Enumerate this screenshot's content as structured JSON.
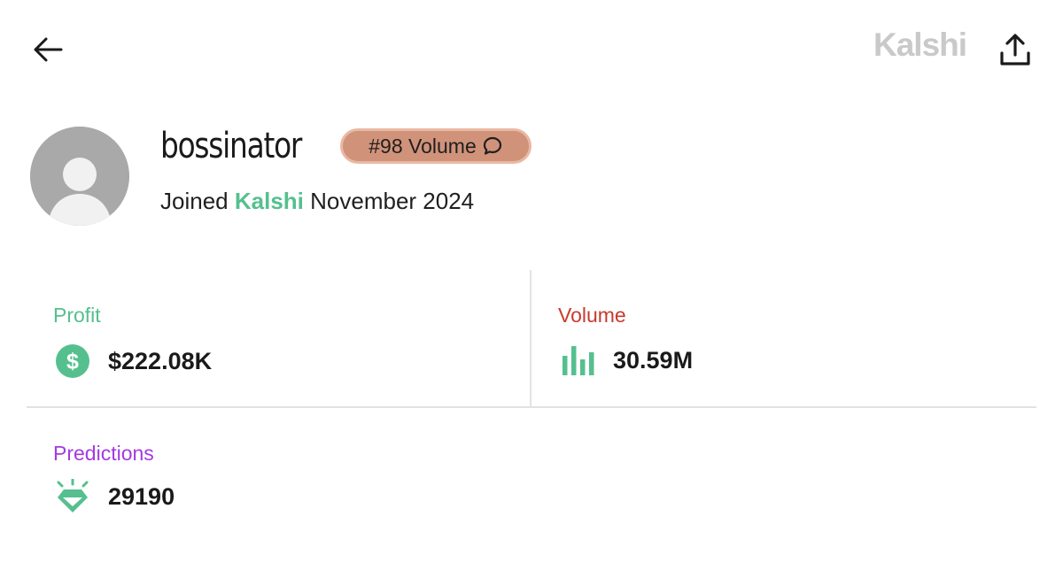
{
  "header": {
    "brand": "Kalshi"
  },
  "profile": {
    "username": "bossinator",
    "badge": "#98 Volume",
    "joined_prefix": "Joined",
    "joined_brand": "Kalshi",
    "joined_date": "November 2024"
  },
  "stats": {
    "profit": {
      "label": "Profit",
      "value": "$222.08K",
      "icon": "dollar-circle-icon",
      "color": "#55c08e"
    },
    "volume": {
      "label": "Volume",
      "value": "30.59M",
      "icon": "bar-chart-icon",
      "color": "#c93a2e"
    },
    "predictions": {
      "label": "Predictions",
      "value": "29190",
      "icon": "diamond-icon",
      "color": "#a43ae0"
    }
  },
  "colors": {
    "accent_green": "#55c08e",
    "badge_bg": "#d1927a",
    "logo_gray": "#c9c9c9"
  }
}
